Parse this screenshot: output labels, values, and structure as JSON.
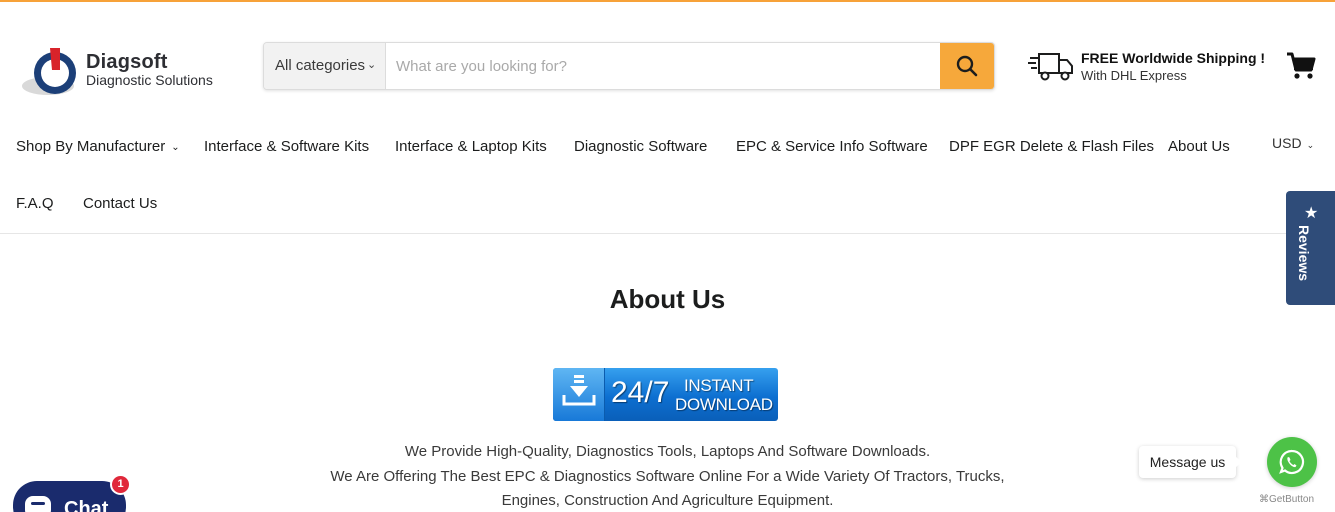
{
  "brand": {
    "name": "Diagsoft",
    "tagline": "Diagnostic Solutions"
  },
  "search": {
    "category_label": "All categories",
    "placeholder": "What are you looking for?",
    "value": ""
  },
  "shipping": {
    "title": "FREE Worldwide Shipping !",
    "subtitle": "With DHL Express"
  },
  "nav": {
    "items": [
      {
        "label": "Shop By Manufacturer",
        "has_dropdown": true
      },
      {
        "label": "Interface & Software Kits"
      },
      {
        "label": "Interface & Laptop Kits"
      },
      {
        "label": "Diagnostic Software"
      },
      {
        "label": "EPC & Service Info Software"
      },
      {
        "label": "DPF EGR Delete & Flash Files"
      },
      {
        "label": "About Us"
      },
      {
        "label": "F.A.Q"
      },
      {
        "label": "Contact Us"
      }
    ],
    "currency": "USD"
  },
  "reviews_tab": {
    "label": "Reviews"
  },
  "main": {
    "title": "About Us",
    "banner": {
      "big": "24/7",
      "line1": "INSTANT",
      "line2": "DOWNLOAD"
    },
    "paragraphs": [
      "We Provide High-Quality, Diagnostics Tools, Laptops And Software Downloads.",
      "We Are Offering The Best EPC & Diagnostics Software Online For a Wide Variety Of Tractors, Trucks,",
      "Engines, Construction And Agriculture Equipment."
    ]
  },
  "chat": {
    "label": "Chat",
    "badge": "1"
  },
  "whatsapp": {
    "message": "Message us",
    "credit": "GetButton"
  },
  "colors": {
    "accent": "#f7a239",
    "search_button": "#f6a83b",
    "reviews_tab": "#2f4c79",
    "chat": "#1a2b6d",
    "whatsapp": "#4dc247",
    "badge": "#e0283a"
  }
}
